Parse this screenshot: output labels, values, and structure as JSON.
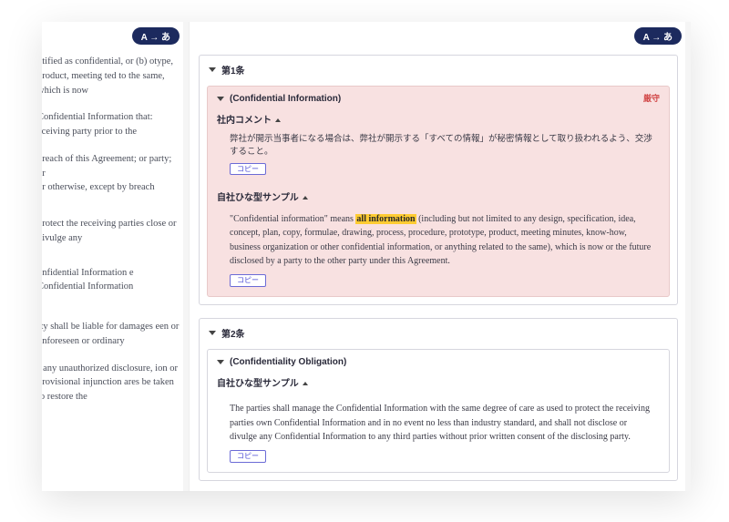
{
  "translate_label": "A → あ",
  "left_text": {
    "p1": "ntified as confidential, or (b) otype, product, meeting ted to the same, which is now",
    "p2": "Confidential Information that: eceiving party prior to the",
    "p3": "breach of this Agreement; or party; or\nor otherwise, except by breach",
    "p4": "protect the receiving parties close or divulge any",
    "p5": "onfidential Information e Confidential Information",
    "p6": "rty shall be liable for damages een or unforeseen or ordinary",
    "p7": "r any unauthorized disclosure, ion or provisional injunction ares be taken to restore the"
  },
  "articles": [
    {
      "title": "第1条",
      "clause_title": "(Confidential Information)",
      "tag": "厳守",
      "comment_label": "社内コメント",
      "comment_body": "弊社が開示当事者になる場合は、弊社が開示する「すべての情報」が秘密情報として取り扱われるよう、交渉すること。",
      "copy_label": "コピー",
      "sample_label": "自社ひな型サンプル",
      "sample_pre": "\"Confidential information\" means ",
      "sample_highlight": "all information",
      "sample_post": " (including but not limited to any design, specification, idea, concept, plan, copy, formulae, drawing, process, procedure, prototype, product, meeting minutes, know-how, business organization or other confidential information, or anything related to the same), which is now or the future disclosed by a party to the other party under this Agreement."
    },
    {
      "title": "第2条",
      "clause_title": "(Confidentiality Obligation)",
      "sample_label": "自社ひな型サンプル",
      "copy_label": "コピー",
      "sample": "The parties shall manage the Confidential Information with the same degree of care as used to protect the receiving parties own Confidential Information and in no event no less than industry standard, and shall not disclose or divulge any Confidential Information to any third parties without prior written consent of the disclosing party."
    }
  ]
}
